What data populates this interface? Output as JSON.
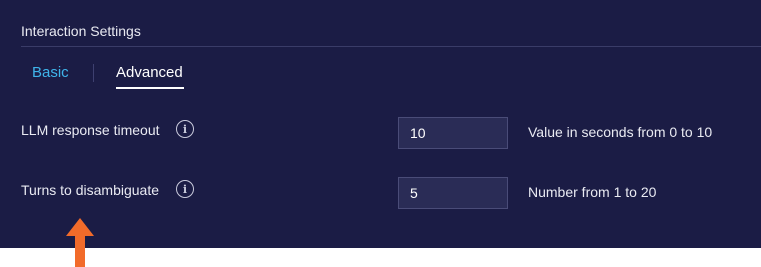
{
  "section": {
    "title": "Interaction Settings"
  },
  "tabs": [
    {
      "label": "Basic",
      "active": false
    },
    {
      "label": "Advanced",
      "active": true
    }
  ],
  "settings": [
    {
      "label": "LLM response timeout",
      "info_icon": "info-icon",
      "value": "10",
      "hint": "Value in seconds from 0 to 10"
    },
    {
      "label": "Turns to disambiguate",
      "info_icon": "info-icon",
      "value": "5",
      "hint": "Number from 1 to 20"
    }
  ],
  "colors": {
    "panel_bg": "#1b1c45",
    "active_tab_accent": "#3fb4ea",
    "annotation_arrow": "#f26b2a"
  }
}
